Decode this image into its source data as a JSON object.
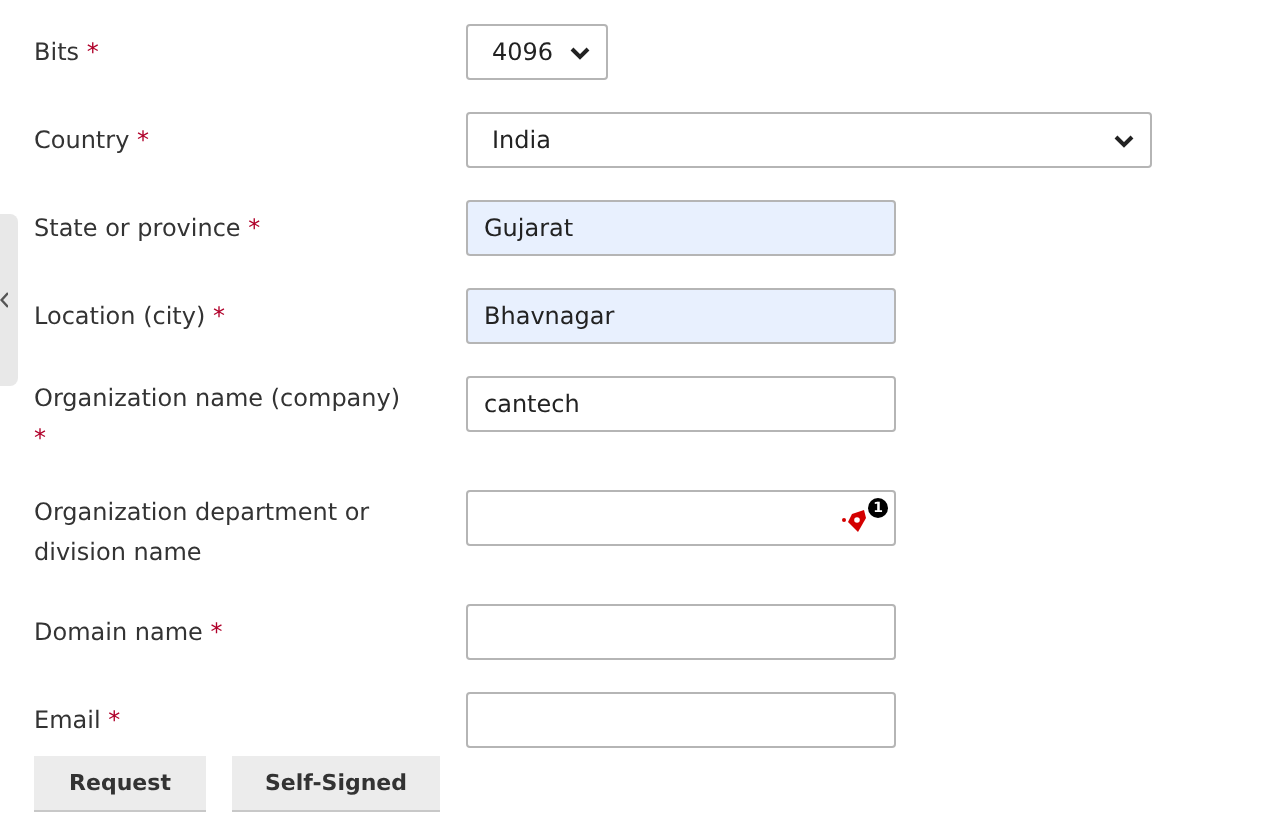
{
  "fields": [
    {
      "label": "Bits",
      "required_mark": "*",
      "kind": "short-select",
      "value": "4096"
    },
    {
      "label": "Country",
      "required_mark": "*",
      "kind": "select",
      "value": "India"
    },
    {
      "label": "State or province",
      "required_mark": "*",
      "kind": "text",
      "value": "Gujarat",
      "autofilled": true
    },
    {
      "label": "Location (city)",
      "required_mark": "*",
      "kind": "text",
      "value": "Bhavnagar",
      "autofilled": true
    },
    {
      "label": "Organization name (company)",
      "required_mark": "*",
      "kind": "text",
      "value": "cantech",
      "autofilled": false
    },
    {
      "label": "Organization department or division name",
      "kind": "text",
      "autofilled": false,
      "extension_badge": "1"
    },
    {
      "label": "Domain name",
      "required_mark": "*",
      "kind": "text",
      "autofilled": false
    },
    {
      "label": "Email",
      "required_mark": "*",
      "kind": "text",
      "autofilled": false
    }
  ],
  "buttons": [
    "Request",
    "Self-Signed"
  ]
}
